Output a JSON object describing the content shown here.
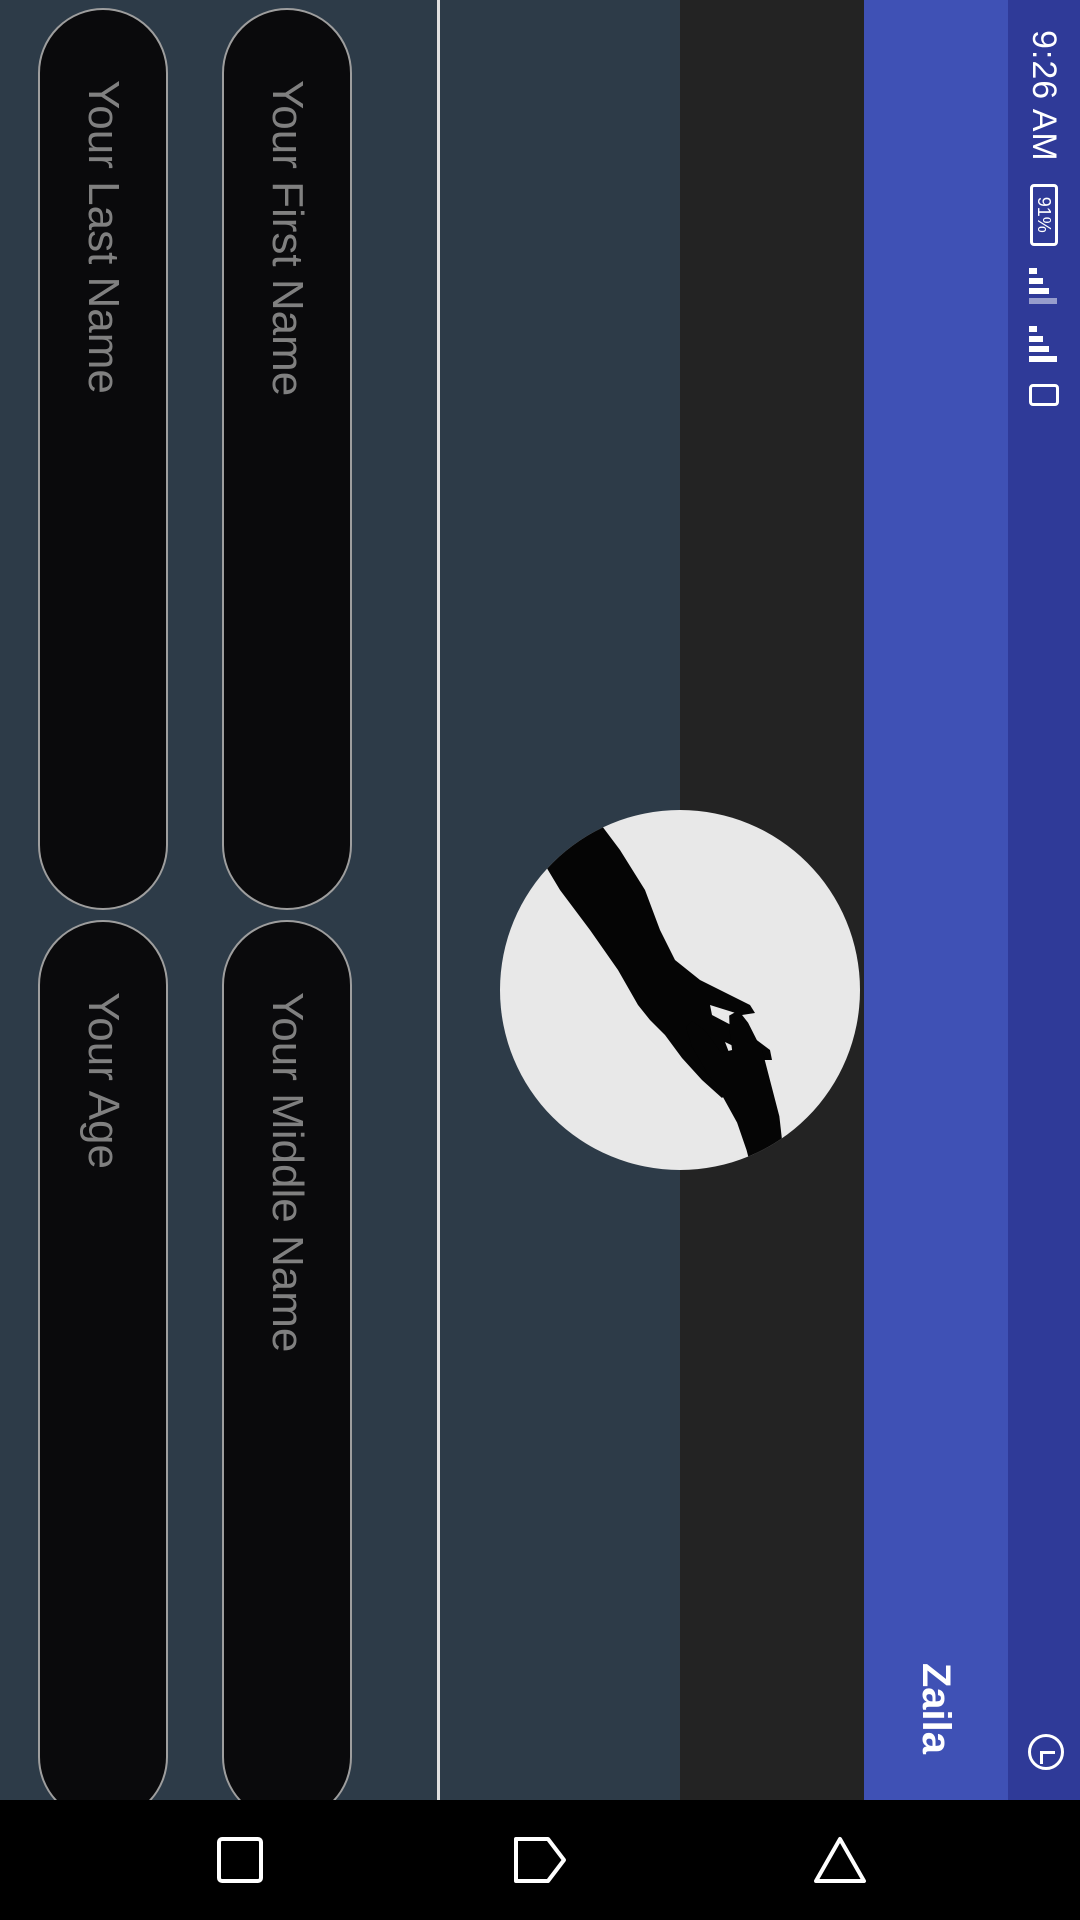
{
  "status_bar": {
    "time": "9:26 AM",
    "battery": "91%",
    "icons": [
      "vibrate-icon",
      "signal-icon",
      "battery-icon",
      "alarm-icon"
    ]
  },
  "app_bar": {
    "title": "Zaila"
  },
  "avatar": {
    "icon": "reaching-hands-icon"
  },
  "form": {
    "first_name": {
      "placeholder": "Your First Name",
      "value": ""
    },
    "middle_name": {
      "placeholder": "Your Middle Name",
      "value": ""
    },
    "last_name": {
      "placeholder": "Your Last Name",
      "value": ""
    },
    "age": {
      "placeholder": "Your Age",
      "value": ""
    }
  },
  "nav_bar": {
    "icons": [
      "recent-apps-icon",
      "back-icon",
      "home-icon"
    ]
  },
  "colors": {
    "primary": "#3f51b5",
    "primary_dark": "#2f3a98",
    "background": "#2d3b48",
    "input_bg": "#0a0a0c"
  }
}
